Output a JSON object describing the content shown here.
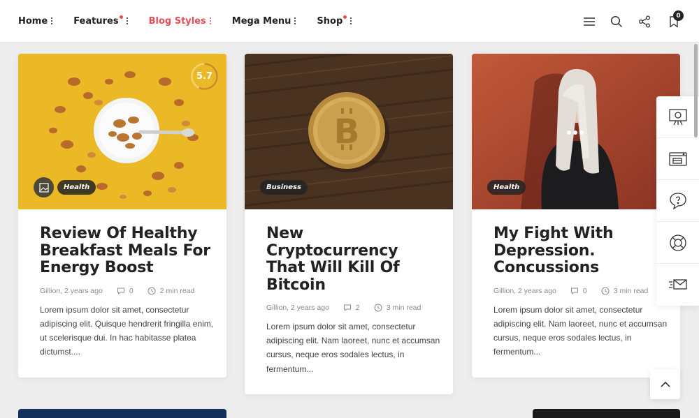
{
  "nav": {
    "items": [
      {
        "label": "Home",
        "dot": false,
        "active": false
      },
      {
        "label": "Features",
        "dot": true,
        "active": false
      },
      {
        "label": "Blog Styles",
        "dot": false,
        "active": true
      },
      {
        "label": "Mega Menu",
        "dot": false,
        "active": false
      },
      {
        "label": "Shop",
        "dot": true,
        "active": false
      }
    ],
    "accent_color": "#e94b57"
  },
  "toolbar": {
    "icons": [
      "menu-icon",
      "search-icon",
      "share-icon",
      "bookmark-icon"
    ],
    "bookmark_count": "0"
  },
  "posts": [
    {
      "category": "Health",
      "score": "5.7",
      "score_fraction": 0.57,
      "title": "Review Of Healthy Breakfast Meals For Energy Boost",
      "author_time": "Gillion, 2 years ago",
      "comments": "0",
      "read_time": "2 min read",
      "excerpt": "Lorem ipsum dolor sit amet, consectetur adipiscing elit. Quisque hendrerit fringilla enim, ut scelerisque dui. In hac habitasse platea dictumst...."
    },
    {
      "category": "Business",
      "title": "New Cryptocurrency That Will Kill Of Bitcoin",
      "author_time": "Gillion, 2 years ago",
      "comments": "2",
      "read_time": "3 min read",
      "excerpt": "Lorem ipsum dolor sit amet, consectetur adipiscing elit. Nam laoreet, nunc et accumsan cursus, neque eros sodales lectus, in fermentum..."
    },
    {
      "category": "Health",
      "title": "My Fight With Depression. Concussions",
      "author_time": "Gillion, 2 years ago",
      "comments": "0",
      "read_time": "3 min read",
      "excerpt": "Lorem ipsum dolor sit amet, consectetur adipiscing elit. Nam laoreet, nunc et accumsan cursus, neque eros sodales lectus, in fermentum..."
    }
  ],
  "dock": {
    "icons": [
      "presentation-icon",
      "browser-payment-icon",
      "help-chat-icon",
      "lifebuoy-icon",
      "fast-mail-icon"
    ]
  },
  "colors": {
    "page_bg": "#ededed",
    "card_bg": "#ffffff",
    "tag_bg": "#232323"
  }
}
